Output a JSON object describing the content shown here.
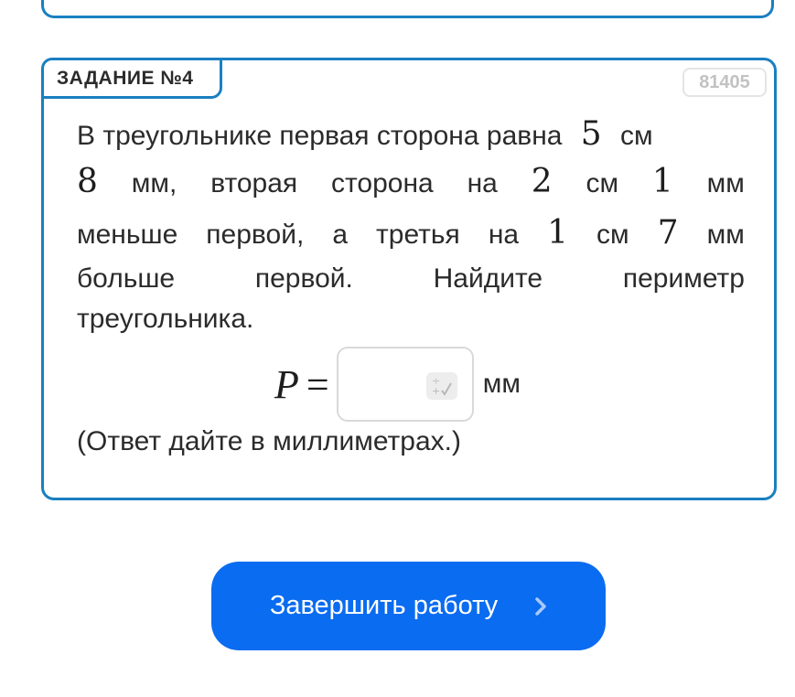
{
  "task": {
    "label": "ЗАДАНИЕ №4",
    "id": "81405",
    "lines": {
      "l1": {
        "t1": "В треугольнике первая сторона равна",
        "n1": "5",
        "t2": "см"
      },
      "l2": {
        "n1": "8",
        "t1": "мм,",
        "t2": "вторая",
        "t3": "сторона",
        "t4": "на",
        "n2": "2",
        "t5": "см",
        "n3": "1",
        "t6": "мм"
      },
      "l3": {
        "t1": "меньше",
        "t2": "первой,",
        "t3": "а",
        "t4": "третья",
        "t5": "на",
        "n1": "1",
        "t6": "см",
        "n2": "7",
        "t7": "мм"
      },
      "l4": {
        "t1": "больше",
        "t2": "первой.",
        "t3": "Найдите",
        "t4": "периметр"
      },
      "l5": {
        "t1": "треугольника."
      }
    },
    "formula": {
      "variable": "P",
      "equals": "=",
      "unit": "мм",
      "answer_value": ""
    },
    "hint": "(Ответ дайте в миллиметрах.)"
  },
  "finish_button": {
    "label": "Завершить работу"
  },
  "icons": {
    "calculator": "calculator-icon",
    "chevron": "chevron-right-icon"
  },
  "colors": {
    "accent": "#1a7fc1",
    "button": "#0a6cf0"
  }
}
